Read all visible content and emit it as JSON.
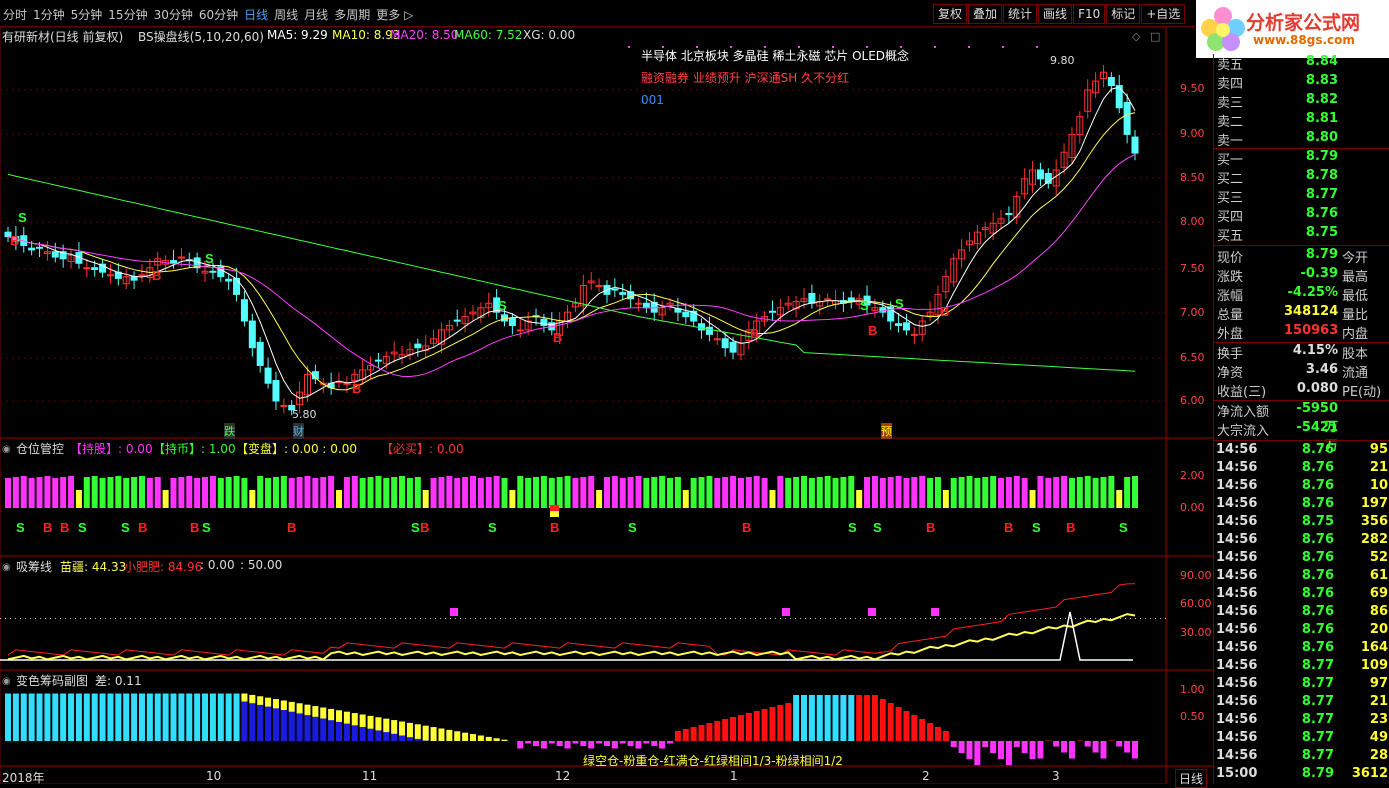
{
  "periods": [
    "分时",
    "1分钟",
    "5分钟",
    "15分钟",
    "30分钟",
    "60分钟",
    "日线",
    "周线",
    "月线",
    "多周期",
    "更多 ▷"
  ],
  "active_period": "日线",
  "toolbar": [
    "复权",
    "叠加",
    "统计",
    "画线",
    "F10",
    "标记",
    "+自选"
  ],
  "logo": {
    "title": "分析家公式网",
    "url": "www.88gs.com"
  },
  "main": {
    "stock": "有研新材(日线 前复权)",
    "indicator": "BS操盘线(5,10,20,60)",
    "ma5": "MA5: 9.29",
    "ma10": "MA10: 8.93",
    "ma20": "MA20: 8.50",
    "ma60": "MA60: 7.52",
    "xg": "XG: 0.00",
    "concepts1": "半导体     北京板块   多晶硅 稀土永磁 芯片 OLED概念",
    "concepts2": "融资融券 业绩预升 沪深通SH 久不分红",
    "code": "001",
    "high_label": "9.80",
    "low_label": "5.80",
    "y_labels": [
      "9.50",
      "9.00",
      "8.50",
      "8.00",
      "7.50",
      "7.00",
      "6.50",
      "6.00"
    ],
    "notes": [
      "跌",
      "财",
      "预"
    ]
  },
  "sub1": {
    "title": "仓位管控",
    "a": "【持股】: 0.00",
    "b": "【持币】: 1.00",
    "c": "【变盘】: 0.00 : 0.00",
    "d": "【必买】: 0.00",
    "y_labels": [
      "2.00",
      "0.00"
    ]
  },
  "sub2": {
    "title": "吸筹线",
    "a": "苗疆: 44.33",
    "b": "小肥肥: 84.96",
    "c": ": 0.00",
    "d": ": 50.00",
    "y_labels": [
      "90.00",
      "60.00",
      "30.00"
    ]
  },
  "sub3": {
    "title": "变色筹码副图",
    "a": "差: 0.11",
    "legend": "绿空仓-粉重仓-红满仓-红绿相间1/3-粉绿相间1/2",
    "y_labels": [
      "1.00",
      "0.50"
    ]
  },
  "dates": [
    "2018年",
    "10",
    "11",
    "12",
    "1",
    "2",
    "3"
  ],
  "bottom_tab": "日线",
  "colors": {
    "up": "#ff3232",
    "down": "#54ffff",
    "ma5": "#ffffff",
    "ma10": "#ffff55",
    "ma20": "#ff40ff",
    "ma60": "#40ff40",
    "magenta": "#ff33ff",
    "green": "#33ff33"
  },
  "orderbook": [
    {
      "n": "卖五",
      "v": "8.84"
    },
    {
      "n": "卖四",
      "v": "8.83"
    },
    {
      "n": "卖三",
      "v": "8.82"
    },
    {
      "n": "卖二",
      "v": "8.81"
    },
    {
      "n": "卖一",
      "v": "8.80"
    },
    {
      "n": "买一",
      "v": "8.79"
    },
    {
      "n": "买二",
      "v": "8.78"
    },
    {
      "n": "买三",
      "v": "8.77"
    },
    {
      "n": "买四",
      "v": "8.76"
    },
    {
      "n": "买五",
      "v": "8.75"
    }
  ],
  "stats": [
    {
      "n": "现价",
      "v": "8.79",
      "c": "#33ff33",
      "n2": "今开"
    },
    {
      "n": "涨跌",
      "v": "-0.39",
      "c": "#33ff33",
      "n2": "最高"
    },
    {
      "n": "涨幅",
      "v": "-4.25%",
      "c": "#33ff33",
      "n2": "最低"
    },
    {
      "n": "总量",
      "v": "348124",
      "c": "#ffff33",
      "n2": "量比"
    },
    {
      "n": "外盘",
      "v": "150963",
      "c": "#ff3333",
      "n2": "内盘"
    },
    {
      "n": "换手",
      "v": "4.15%",
      "c": "#dddddd",
      "n2": "股本"
    },
    {
      "n": "净资",
      "v": "3.46",
      "c": "#dddddd",
      "n2": "流通"
    },
    {
      "n": "收益(三)",
      "v": "0.080",
      "c": "#dddddd",
      "n2": "PE(动)"
    },
    {
      "n": "净流入额",
      "v": "-5950万",
      "c": "#33ff33",
      "n2": ""
    },
    {
      "n": "大宗流入",
      "v": "-5421万",
      "c": "#33ff33",
      "n2": ""
    }
  ],
  "ticks": [
    {
      "t": "14:56",
      "p": "8.76",
      "q": "95"
    },
    {
      "t": "14:56",
      "p": "8.76",
      "q": "21"
    },
    {
      "t": "14:56",
      "p": "8.76",
      "q": "10"
    },
    {
      "t": "14:56",
      "p": "8.76",
      "q": "197"
    },
    {
      "t": "14:56",
      "p": "8.75",
      "q": "356"
    },
    {
      "t": "14:56",
      "p": "8.76",
      "q": "282"
    },
    {
      "t": "14:56",
      "p": "8.76",
      "q": "52"
    },
    {
      "t": "14:56",
      "p": "8.76",
      "q": "61"
    },
    {
      "t": "14:56",
      "p": "8.76",
      "q": "69"
    },
    {
      "t": "14:56",
      "p": "8.76",
      "q": "86"
    },
    {
      "t": "14:56",
      "p": "8.76",
      "q": "20"
    },
    {
      "t": "14:56",
      "p": "8.76",
      "q": "164"
    },
    {
      "t": "14:56",
      "p": "8.77",
      "q": "109"
    },
    {
      "t": "14:56",
      "p": "8.77",
      "q": "97"
    },
    {
      "t": "14:56",
      "p": "8.77",
      "q": "21"
    },
    {
      "t": "14:56",
      "p": "8.77",
      "q": "23"
    },
    {
      "t": "14:56",
      "p": "8.77",
      "q": "49"
    },
    {
      "t": "14:56",
      "p": "8.77",
      "q": "28"
    },
    {
      "t": "15:00",
      "p": "8.79",
      "q": "3612"
    }
  ],
  "chart_data": {
    "type": "candlestick",
    "title": "有研新材(日线 前复权)",
    "ylim": [
      5.7,
      9.9
    ],
    "high": 9.8,
    "low": 5.8,
    "bs_signals_main": [
      "B",
      "S",
      "S",
      "B",
      "S",
      "B",
      "S",
      "B",
      "S",
      "B",
      "S",
      "B",
      "S",
      "B",
      "S",
      "B",
      "B"
    ],
    "sub1_signals": [
      "S",
      "B",
      "B",
      "S",
      "S",
      "B",
      "BS",
      "B",
      "SB",
      "S",
      "B",
      "S",
      "B",
      "S",
      "S",
      "B",
      "B",
      "S",
      "B",
      "S"
    ],
    "closes": [
      7.85,
      7.8,
      7.75,
      7.7,
      7.72,
      7.68,
      7.62,
      7.6,
      7.64,
      7.55,
      7.5,
      7.48,
      7.45,
      7.42,
      7.38,
      7.4,
      7.36,
      7.42,
      7.5,
      7.6,
      7.58,
      7.55,
      7.62,
      7.58,
      7.5,
      7.46,
      7.45,
      7.4,
      7.35,
      7.2,
      6.9,
      6.6,
      6.4,
      6.2,
      6.0,
      5.95,
      5.9,
      6.1,
      6.3,
      6.25,
      6.2,
      6.15,
      6.22,
      6.2,
      6.3,
      6.35,
      6.4,
      6.45,
      6.5,
      6.55,
      6.52,
      6.58,
      6.6,
      6.62,
      6.7,
      6.8,
      6.85,
      6.9,
      6.95,
      7.0,
      7.05,
      7.1,
      7.0,
      6.9,
      6.85,
      6.8,
      6.9,
      6.95,
      6.85,
      6.8,
      6.9,
      7.0,
      7.1,
      7.3,
      7.35,
      7.3,
      7.2,
      7.25,
      7.2,
      7.15,
      7.1,
      7.05,
      7.0,
      7.05,
      7.1,
      7.0,
      6.95,
      6.9,
      6.8,
      6.75,
      6.7,
      6.6,
      6.55,
      6.65,
      6.8,
      6.9,
      6.95,
      7.0,
      7.05,
      7.1,
      7.12,
      7.15,
      7.1,
      7.12,
      7.15,
      7.13,
      7.1,
      7.12,
      7.15,
      7.08,
      7.05,
      7.0,
      6.9,
      6.85,
      6.8,
      6.75,
      6.9,
      7.0,
      7.2,
      7.4,
      7.6,
      7.7,
      7.8,
      7.9,
      7.95,
      8.0,
      8.05,
      8.1,
      8.3,
      8.5,
      8.6,
      8.5,
      8.45,
      8.6,
      8.8,
      9.0,
      9.2,
      9.5,
      9.6,
      9.7,
      9.55,
      9.3,
      9.0,
      8.79
    ]
  }
}
